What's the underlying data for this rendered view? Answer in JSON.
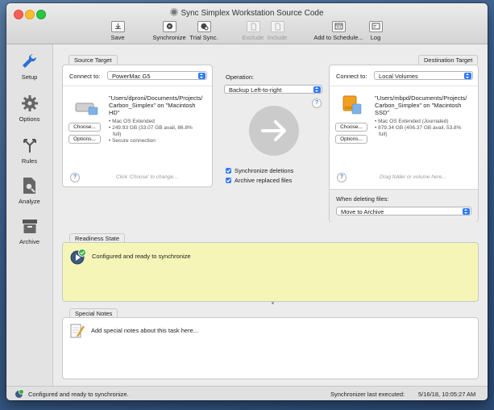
{
  "window": {
    "title": "Sync Simplex Workstation Source Code"
  },
  "toolbar": {
    "save": "Save",
    "synchronize": "Synchronize",
    "trial_sync": "Trial Sync.",
    "exclude": "Exclude",
    "include": "Include",
    "add_to_schedule": "Add to Schedule...",
    "log": "Log"
  },
  "sidebar": {
    "items": [
      {
        "label": "Setup",
        "icon": "wrench-icon"
      },
      {
        "label": "Options",
        "icon": "gear-icon"
      },
      {
        "label": "Rules",
        "icon": "rules-icon"
      },
      {
        "label": "Analyze",
        "icon": "analyze-icon"
      },
      {
        "label": "Archive",
        "icon": "archive-icon"
      }
    ]
  },
  "source": {
    "tab": "Source Target",
    "connect_label": "Connect to:",
    "connect_value": "PowerMac G5",
    "path_lines": [
      "\"Users/dproni/Documents/Projects/",
      "Carbon_Simplex\" on \"Macintosh",
      "HD\""
    ],
    "details": [
      "• Mac OS Extended",
      "• 249.93 GB (33.07 GB avail, 86.8%",
      "  full)",
      "• Secure connection"
    ],
    "choose": "Choose...",
    "options": "Options...",
    "hint": "Click 'Choose' to change..."
  },
  "operation": {
    "label": "Operation:",
    "value": "Backup Left-to-right",
    "sync_deletions": "Synchronize deletions",
    "archive_replaced": "Archive replaced files"
  },
  "destination": {
    "tab": "Destination Target",
    "connect_label": "Connect to:",
    "connect_value": "Local Volumes",
    "path_lines": [
      "\"Users/mbpd/Documents/Projects/",
      "Carbon_Simplex\" on \"Macintosh",
      "SSD\""
    ],
    "details": [
      "• Mac OS Extended (Journaled)",
      "• 879.34 GB (406.37 GB avail, 53.8%",
      "  full)"
    ],
    "choose": "Choose...",
    "options": "Options...",
    "hint": "Drag folder or volume here...",
    "when_deleting_label": "When deleting files:",
    "when_deleting_value": "Move to Archive"
  },
  "readiness": {
    "tab": "Readiness State",
    "message": "Configured and ready to synchronize"
  },
  "notes": {
    "tab": "Special Notes",
    "placeholder": "Add special notes about this task here..."
  },
  "status": {
    "left": "Configured and ready to synchronize.",
    "right_label": "Synchronizer last executed:",
    "right_value": "5/16/18, 10:05:27 AM"
  },
  "colors": {
    "accent": "#2f7bf5",
    "readiness_bg": "#f5f5b8",
    "drive_orange": "#f0a020"
  }
}
